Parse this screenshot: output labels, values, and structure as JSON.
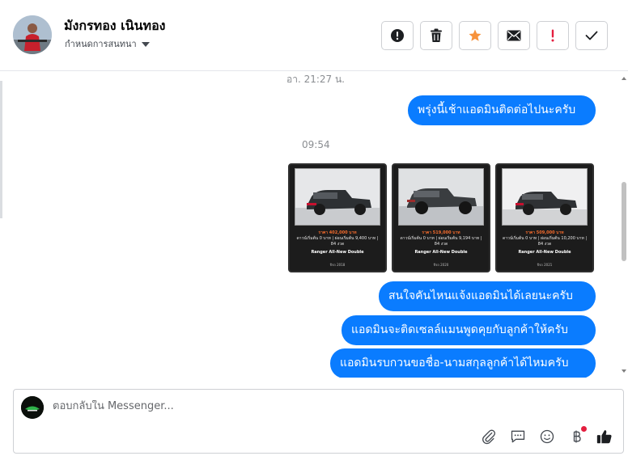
{
  "contact": {
    "name": "มังกรทอง เนินทอง",
    "subtitle": "กำหนดการสนทนา"
  },
  "toolbar": {
    "buttons": [
      {
        "name": "report",
        "icon": "exclamation-circle-icon",
        "color": "#1c1e21"
      },
      {
        "name": "delete",
        "icon": "trash-icon",
        "color": "#1c1e21"
      },
      {
        "name": "star",
        "icon": "star-icon",
        "color": "#f7923b"
      },
      {
        "name": "mark-unread",
        "icon": "envelope-icon",
        "color": "#1c1e21"
      },
      {
        "name": "priority",
        "icon": "exclamation-icon",
        "color": "#e41e3f"
      },
      {
        "name": "done",
        "icon": "check-icon",
        "color": "#1c1e21"
      }
    ]
  },
  "chat": {
    "timestamp_top": "อา. 21:27 น.",
    "timestamp_mid": "09:54",
    "messages": [
      "พรุ่งนี้เช้าแอดมินติดต่อไปนะครับ",
      "สนใจคันไหนแจ้งแอดมินได้เลยนะครับ",
      "แอดมินจะติดเซลล์แมนพูดคุยกับลูกค้าให้ครับ",
      "แอดมินรบกวนขอชื่อ-นามสกุลลูกค้าได้ไหมครับ"
    ],
    "cards": [
      {
        "price": "ราคา 402,000 บาท",
        "terms": "ดาวน์เริ่มต้น 0 บาท | ผ่อนเริ่มต้น 9,400 บาท | 84 งวด",
        "model": "Ranger All-New Double",
        "footer": "ปีรถ 2018"
      },
      {
        "price": "ราคา 519,000 บาท",
        "terms": "ดาวน์เริ่มต้น 0 บาท | ผ่อนเริ่มต้น 9,194 บาท | 84 งวด",
        "model": "Ranger All-New Double",
        "footer": "ปีรถ 2020"
      },
      {
        "price": "ราคา 509,000 บาท",
        "terms": "ดาวน์เริ่มต้น 0 บาท | ผ่อนเริ่มต้น 10,200 บาท | 84 งวด",
        "model": "Ranger All-New Double",
        "footer": "ปีรถ 2021"
      }
    ]
  },
  "composer": {
    "placeholder": "ตอบกลับใน Messenger..."
  },
  "colors": {
    "bubble": "#0a7cff",
    "like": "#1c1e21"
  }
}
